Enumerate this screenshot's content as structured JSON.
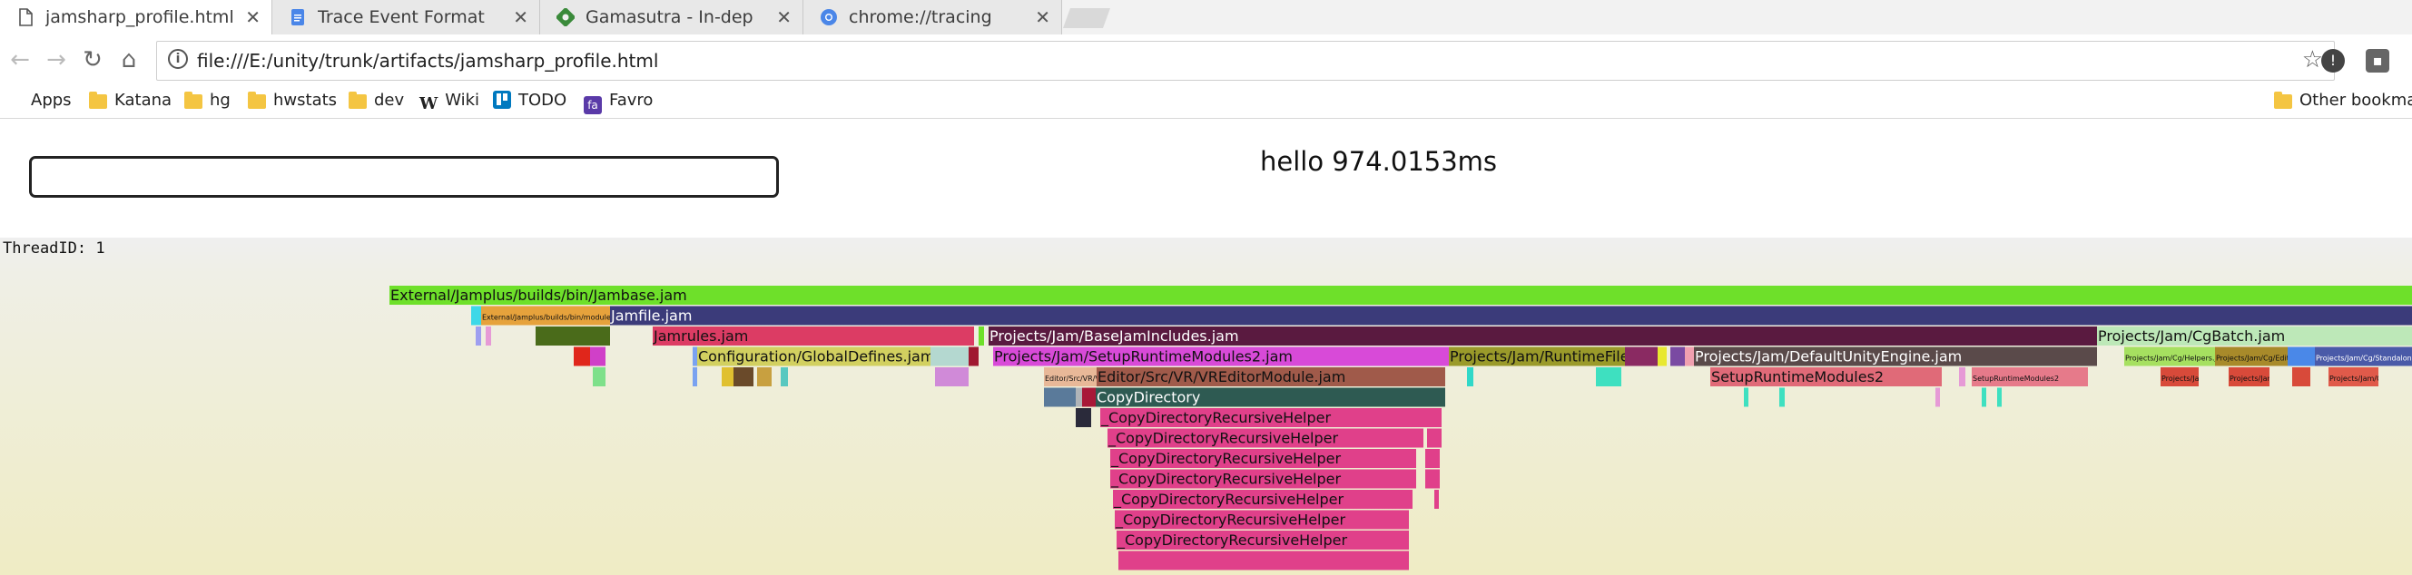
{
  "tabs": [
    {
      "title": "jamsharp_profile.html",
      "icon": "document-icon",
      "active": true
    },
    {
      "title": "Trace Event Format - Goo",
      "icon": "google-docs-icon",
      "active": false
    },
    {
      "title": "Gamasutra - In-depth: U",
      "icon": "gamasutra-icon",
      "active": false
    },
    {
      "title": "chrome://tracing",
      "icon": "chrome-icon",
      "active": false
    }
  ],
  "toolbar": {
    "url": "file:///E:/unity/trunk/artifacts/jamsharp_profile.html"
  },
  "bookmarks": [
    {
      "label": "Apps",
      "icon": "apps-grid-icon"
    },
    {
      "label": "Katana",
      "icon": "folder-icon"
    },
    {
      "label": "hg",
      "icon": "folder-icon"
    },
    {
      "label": "hwstats",
      "icon": "folder-icon"
    },
    {
      "label": "dev",
      "icon": "folder-icon"
    },
    {
      "label": "Wiki",
      "icon": "wikipedia-icon"
    },
    {
      "label": "TODO",
      "icon": "trello-icon"
    },
    {
      "label": "Favro",
      "icon": "favro-icon"
    }
  ],
  "other_bookmarks": "Other bookmar",
  "page": {
    "hello": "hello 974.0153ms",
    "search_value": "",
    "thread_label": "ThreadID: 1"
  },
  "flame": [
    {
      "label": "External/Jamplus/builds/bin/Jambase.jam",
      "start": 429,
      "end": 2657,
      "depth": 0,
      "color": "#6ee02a"
    },
    {
      "label": "",
      "start": 519,
      "end": 530,
      "depth": 1,
      "color": "#3dd8e8"
    },
    {
      "label": "External/Jamplus/builds/bin/modules",
      "start": 530,
      "end": 672,
      "depth": 1,
      "color": "#e6a23c",
      "small": true
    },
    {
      "label": "",
      "start": 672,
      "end": 672,
      "depth": 1,
      "color": "#aaaaaa"
    },
    {
      "label": "Jamfile.jam",
      "start": 672,
      "end": 2657,
      "depth": 1,
      "color": "#3b3b7a",
      "textColor": "#ffffff"
    },
    {
      "label": "",
      "start": 524,
      "end": 530,
      "depth": 2,
      "color": "#9e9ef0"
    },
    {
      "label": "",
      "start": 535,
      "end": 541,
      "depth": 2,
      "color": "#e69ad6"
    },
    {
      "label": "",
      "start": 590,
      "end": 672,
      "depth": 2,
      "color": "#4a6b1a"
    },
    {
      "label": "Jamrules.jam",
      "start": 719,
      "end": 1073,
      "depth": 2,
      "color": "#dc3c64"
    },
    {
      "label": "",
      "start": 1078,
      "end": 1084,
      "depth": 2,
      "color": "#6ee02a"
    },
    {
      "label": "Projects/Jam/BaseJamIncludes.jam",
      "start": 1089,
      "end": 2310,
      "depth": 2,
      "color": "#5a1a40",
      "textColor": "#ffffff"
    },
    {
      "label": "Projects/Jam/CgBatch.jam",
      "start": 2310,
      "end": 2657,
      "depth": 2,
      "color": "#bde8b8"
    },
    {
      "label": "",
      "start": 632,
      "end": 650,
      "depth": 3,
      "color": "#e0261b"
    },
    {
      "label": "",
      "start": 650,
      "end": 667,
      "depth": 3,
      "color": "#d040c8"
    },
    {
      "label": "",
      "start": 763,
      "end": 768,
      "depth": 3,
      "color": "#7aa2f0"
    },
    {
      "label": "Configuration/GlobalDefines.jam",
      "start": 768,
      "end": 1025,
      "depth": 3,
      "color": "#d2d060"
    },
    {
      "label": "",
      "start": 1025,
      "end": 1067,
      "depth": 3,
      "color": "#b4d8d0"
    },
    {
      "label": "",
      "start": 1067,
      "end": 1078,
      "depth": 3,
      "color": "#a01830"
    },
    {
      "label": "Projects/Jam/SetupRuntimeModules2.jam",
      "start": 1094,
      "end": 1596,
      "depth": 3,
      "color": "#d84ad8"
    },
    {
      "label": "Projects/Jam/RuntimeFiles.jam",
      "start": 1596,
      "end": 1790,
      "depth": 3,
      "color": "#9a9a2a"
    },
    {
      "label": "",
      "start": 1790,
      "end": 1826,
      "depth": 3,
      "color": "#8a2a62"
    },
    {
      "label": "",
      "start": 1826,
      "end": 1836,
      "depth": 3,
      "color": "#e8e830"
    },
    {
      "label": "",
      "start": 1840,
      "end": 1856,
      "depth": 3,
      "color": "#7a4aa2"
    },
    {
      "label": "",
      "start": 1856,
      "end": 1866,
      "depth": 3,
      "color": "#f0a0b0"
    },
    {
      "label": "Projects/Jam/DefaultUnityEngine.jam",
      "start": 1866,
      "end": 2310,
      "depth": 3,
      "color": "#5a4a4a",
      "textColor": "#ffffff"
    },
    {
      "label": "Projects/Jam/Cg/Helpers.jam",
      "start": 2340,
      "end": 2440,
      "depth": 3,
      "color": "#a6e060",
      "small": true
    },
    {
      "label": "Projects/Jam/Cg/Editor.jam",
      "start": 2440,
      "end": 2520,
      "depth": 3,
      "color": "#a88a2a",
      "small": true
    },
    {
      "label": "",
      "start": 2520,
      "end": 2550,
      "depth": 3,
      "color": "#4a88e8"
    },
    {
      "label": "Projects/Jam/Cg/Standalone.jam",
      "start": 2550,
      "end": 2657,
      "depth": 3,
      "color": "#4a5aa8",
      "textColor": "#ffffff",
      "small": true
    },
    {
      "label": "",
      "start": 653,
      "end": 667,
      "depth": 4,
      "color": "#7ee08a"
    },
    {
      "label": "",
      "start": 763,
      "end": 768,
      "depth": 4,
      "color": "#7aa2f0"
    },
    {
      "label": "",
      "start": 795,
      "end": 808,
      "depth": 4,
      "color": "#e0c030"
    },
    {
      "label": "",
      "start": 808,
      "end": 830,
      "depth": 4,
      "color": "#6a4a2a"
    },
    {
      "label": "",
      "start": 834,
      "end": 850,
      "depth": 4,
      "color": "#c8a040"
    },
    {
      "label": "",
      "start": 860,
      "end": 868,
      "depth": 4,
      "color": "#58c8c0"
    },
    {
      "label": "",
      "start": 1030,
      "end": 1067,
      "depth": 4,
      "color": "#d08ad8"
    },
    {
      "label": "Editor/Src/VR/VREditorModule.jam",
      "start": 1150,
      "end": 1208,
      "depth": 4,
      "color": "#e8b898",
      "small": true
    },
    {
      "label": "Editor/Src/VR/VREditorModule.jam",
      "start": 1208,
      "end": 1592,
      "depth": 4,
      "color": "#a05a4a"
    },
    {
      "label": "",
      "start": 1616,
      "end": 1623,
      "depth": 4,
      "color": "#30d8c8"
    },
    {
      "label": "",
      "start": 1758,
      "end": 1786,
      "depth": 4,
      "color": "#3ee0c0"
    },
    {
      "label": "SetupRuntimeModules2",
      "start": 1884,
      "end": 2139,
      "depth": 4,
      "color": "#e06a78"
    },
    {
      "label": "",
      "start": 2158,
      "end": 2165,
      "depth": 4,
      "color": "#e69ad6"
    },
    {
      "label": "SetupRuntimeModules2",
      "start": 2172,
      "end": 2300,
      "depth": 4,
      "color": "#e67a8a",
      "small": true
    },
    {
      "label": "Projects/Jam/Modules.jam",
      "start": 2380,
      "end": 2422,
      "depth": 4,
      "color": "#d84a3a",
      "small": true
    },
    {
      "label": "Projects/Jam/Cg.jam",
      "start": 2455,
      "end": 2500,
      "depth": 4,
      "color": "#d84a3a",
      "small": true
    },
    {
      "label": "",
      "start": 2525,
      "end": 2545,
      "depth": 4,
      "color": "#d84a3a"
    },
    {
      "label": "Projects/Jam/Cg.jam",
      "start": 2565,
      "end": 2620,
      "depth": 4,
      "color": "#e05a4a",
      "small": true
    },
    {
      "label": "",
      "start": 1150,
      "end": 1185,
      "depth": 5,
      "color": "#5a7a9a"
    },
    {
      "label": "",
      "start": 1185,
      "end": 1192,
      "depth": 5,
      "color": "#b0b4b8"
    },
    {
      "label": "",
      "start": 1192,
      "end": 1207,
      "depth": 5,
      "color": "#a81838"
    },
    {
      "label": "CopyDirectory",
      "start": 1207,
      "end": 1592,
      "depth": 5,
      "color": "#2e5a52",
      "textColor": "#ffffff"
    },
    {
      "label": "",
      "start": 1921,
      "end": 1926,
      "depth": 5,
      "color": "#3ee0c0"
    },
    {
      "label": "",
      "start": 1960,
      "end": 1966,
      "depth": 5,
      "color": "#3ee0c0"
    },
    {
      "label": "",
      "start": 2132,
      "end": 2137,
      "depth": 5,
      "color": "#e69ad6"
    },
    {
      "label": "",
      "start": 2183,
      "end": 2188,
      "depth": 5,
      "color": "#3ee0c0"
    },
    {
      "label": "",
      "start": 2200,
      "end": 2205,
      "depth": 5,
      "color": "#3ee0c0"
    },
    {
      "label": "",
      "start": 1185,
      "end": 1202,
      "depth": 6,
      "color": "#2a2a3a"
    },
    {
      "label": "_CopyDirectoryRecursiveHelper",
      "start": 1212,
      "end": 1588,
      "depth": 6,
      "color": "#e0408a"
    },
    {
      "label": "_CopyDirectoryRecursiveHelper",
      "start": 1220,
      "end": 1568,
      "depth": 7,
      "color": "#e0408a"
    },
    {
      "label": "",
      "start": 1572,
      "end": 1588,
      "depth": 7,
      "color": "#e0408a"
    },
    {
      "label": "_CopyDirectoryRecursiveHelper",
      "start": 1223,
      "end": 1560,
      "depth": 8,
      "color": "#e0408a"
    },
    {
      "label": "",
      "start": 1570,
      "end": 1586,
      "depth": 8,
      "color": "#e0408a"
    },
    {
      "label": "_CopyDirectoryRecursiveHelper",
      "start": 1223,
      "end": 1560,
      "depth": 9,
      "color": "#e0408a"
    },
    {
      "label": "",
      "start": 1570,
      "end": 1586,
      "depth": 9,
      "color": "#e0408a"
    },
    {
      "label": "_CopyDirectoryRecursiveHelper",
      "start": 1226,
      "end": 1556,
      "depth": 10,
      "color": "#e0408a"
    },
    {
      "label": "",
      "start": 1580,
      "end": 1585,
      "depth": 10,
      "color": "#e0408a"
    },
    {
      "label": "_CopyDirectoryRecursiveHelper",
      "start": 1228,
      "end": 1552,
      "depth": 11,
      "color": "#e0408a"
    },
    {
      "label": "_CopyDirectoryRecursiveHelper",
      "start": 1230,
      "end": 1552,
      "depth": 12,
      "color": "#e0408a"
    },
    {
      "label": "",
      "start": 1232,
      "end": 1552,
      "depth": 13,
      "color": "#e0408a"
    }
  ]
}
